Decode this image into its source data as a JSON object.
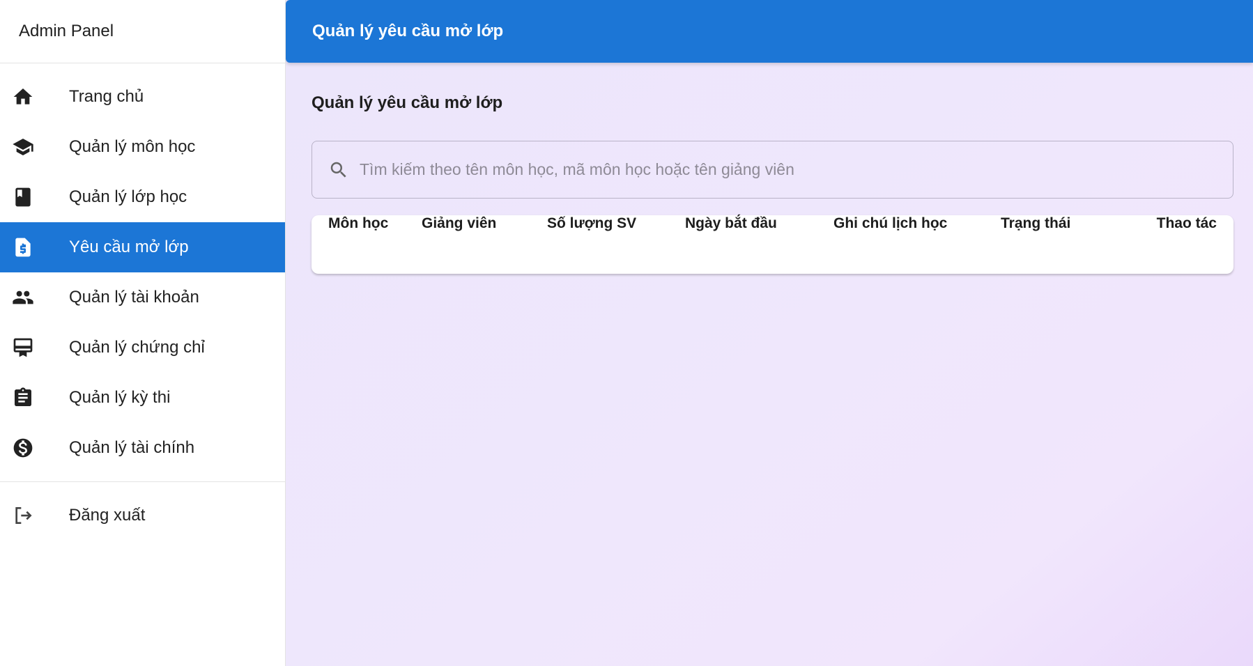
{
  "sidebar": {
    "title": "Admin Panel",
    "items": [
      {
        "label": "Trang chủ",
        "icon": "home-icon"
      },
      {
        "label": "Quản lý môn học",
        "icon": "graduation-cap-icon"
      },
      {
        "label": "Quản lý lớp học",
        "icon": "book-icon"
      },
      {
        "label": "Yêu cầu mở lớp",
        "icon": "request-document-icon",
        "active": true
      },
      {
        "label": "Quản lý tài khoản",
        "icon": "people-icon"
      },
      {
        "label": "Quản lý chứng chỉ",
        "icon": "certificate-icon"
      },
      {
        "label": "Quản lý kỳ thi",
        "icon": "clipboard-icon"
      },
      {
        "label": "Quản lý tài chính",
        "icon": "dollar-circle-icon"
      }
    ],
    "logout_label": "Đăng xuất"
  },
  "topbar": {
    "title": "Quản lý yêu cầu mở lớp"
  },
  "main": {
    "title": "Quản lý yêu cầu mở lớp",
    "search": {
      "placeholder": "Tìm kiếm theo tên môn học, mã môn học hoặc tên giảng viên",
      "value": ""
    },
    "table": {
      "columns": [
        "Môn học",
        "Giảng viên",
        "Số lượng SV",
        "Ngày bắt đầu",
        "Ghi chú lịch học",
        "Trạng thái",
        "Thao tác"
      ],
      "rows": []
    }
  },
  "colors": {
    "accent": "#1c76d6",
    "background": "#ede6fb"
  }
}
